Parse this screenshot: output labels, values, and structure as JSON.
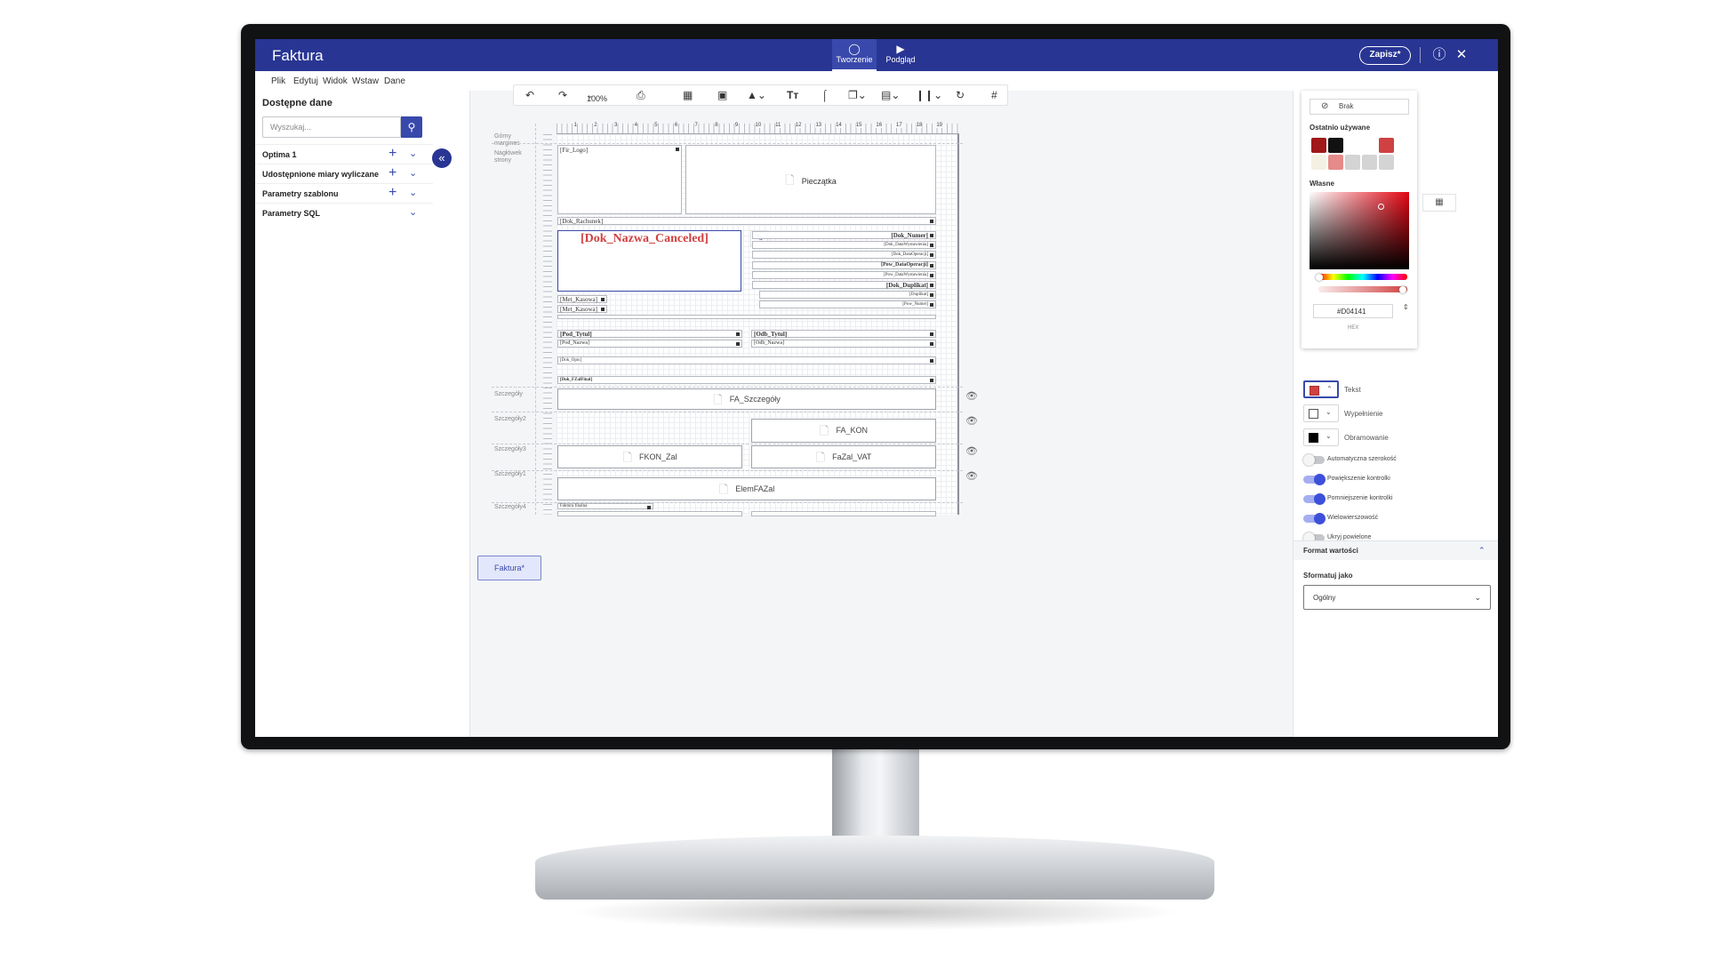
{
  "app": {
    "title": "Faktura",
    "modes": [
      {
        "label": "Tworzenie",
        "icon": "pencil-ruler-icon"
      },
      {
        "label": "Podgląd",
        "icon": "play-icon"
      }
    ],
    "save_label": "Zapisz*",
    "help_icon": "help-icon",
    "close_icon": "close-icon"
  },
  "menu": [
    "Plik",
    "Edytuj",
    "Widok",
    "Wstaw",
    "Dane"
  ],
  "left_panel": {
    "title": "Dostępne dane",
    "search_placeholder": "Wyszukaj...",
    "items": [
      {
        "label": "Optima 1",
        "has_add": true
      },
      {
        "label": "Udostępnione miary wyliczane",
        "has_add": true
      },
      {
        "label": "Parametry szablonu",
        "has_add": true
      },
      {
        "label": "Parametry SQL",
        "has_add": false
      }
    ]
  },
  "toolbar": {
    "zoom": "100%",
    "tools": [
      "undo-icon",
      "redo-icon",
      "zoom-select",
      "print-icon",
      "table-icon",
      "image-icon",
      "shapes-icon",
      "text-icon",
      "attachment-icon",
      "layers-icon",
      "layout-icon",
      "columns-icon",
      "refresh-icon",
      "hash-icon"
    ]
  },
  "canvas": {
    "ruler_numbers": [
      "1",
      "2",
      "3",
      "4",
      "5",
      "6",
      "7",
      "8",
      "9",
      "10",
      "11",
      "12",
      "13",
      "14",
      "15",
      "16",
      "17",
      "18",
      "19"
    ],
    "sections": [
      {
        "label": "Górny margines"
      },
      {
        "label": "Nagłówek strony"
      },
      {
        "label": "Szczegóły"
      },
      {
        "label": "Szczegóły2"
      },
      {
        "label": "Szczegóły3"
      },
      {
        "label": "Szczegóły1"
      },
      {
        "label": "Szczegóły4"
      }
    ],
    "fields": {
      "fir_logo": "[Fir_Logo]",
      "pieczatka": "Pieczątka",
      "dok_rachunek": "[Dok_Rachunek]",
      "dok_nazwa_canceled": "[Dok_Nazwa_Canceled]",
      "dok_numer": "[Dok_Numer]",
      "dok_data_wystawienia": "[Dok_DataWystawienia]",
      "dok_data_operacji": "[Dok_DataOperacji]",
      "pow_data_operacji": "[Pow_DataOperacji]",
      "pow_data_wystawienia": "[Pow_DataWystawienia]",
      "dok_duplikat": "[Dok_Duplikat]",
      "duplikat": "[Duplikat]",
      "pow_numer": "[Pow_Numer]",
      "met_kasowa_1": "[Met_Kasowa]",
      "met_kasowa_2": "[Met_Kasowa]",
      "pod_tytul": "[Pod_Tytul]",
      "pod_nazwa": "[Pod_Nazwa]",
      "odb_tytul": "[Odb_Tytul]",
      "odb_nazwa": "[Odb_Nazwa]",
      "dok_opis": "[Dok_Opis]",
      "dok_fzalfinal": "[Dok_FZalFinal]",
      "faktura_finalna": "Faktura finalna"
    },
    "subreports": {
      "fa_szczegoly": "FA_Szczegóły",
      "fa_kon": "FA_KON",
      "fkon_zal": "FKON_Zal",
      "fazal_vat": "FaZal_VAT",
      "elem_fazal": "ElemFAZal"
    },
    "bottom_tab": "Faktura*"
  },
  "right_panel": {
    "color_picker": {
      "none_label": "Brak",
      "recent_label": "Ostatnio używane",
      "recent_colors": [
        "#a01818",
        "#111111",
        "#ffffff",
        "#ffffff",
        "#d04141",
        "#f4f1e4",
        "#e68a8a",
        "#d4d4d4",
        "#d4d4d4",
        "#d4d4d4"
      ],
      "custom_label": "Własne",
      "hex_value": "#D04141",
      "hex_caption": "HEX"
    },
    "color_properties": [
      {
        "label": "Tekst",
        "color": "#d04141",
        "active": true
      },
      {
        "label": "Wypełnienie",
        "color": "#ffffff",
        "active": false
      },
      {
        "label": "Obramowanie",
        "color": "#000000",
        "active": false
      }
    ],
    "toggles": [
      {
        "label": "Automatyczna szerokość",
        "on": false
      },
      {
        "label": "Powiększenie kontrolki",
        "on": true
      },
      {
        "label": "Pomniejszenie kontrolki",
        "on": true
      },
      {
        "label": "Wielowierszowość",
        "on": true
      },
      {
        "label": "Ukryj powielone",
        "on": false
      }
    ],
    "format_section": {
      "title": "Format wartości",
      "format_label": "Sformatuj jako",
      "format_value": "Ogólny"
    }
  },
  "colors": {
    "brand": "#283593",
    "accent": "#3949ab",
    "text_highlight": "#d04141"
  }
}
